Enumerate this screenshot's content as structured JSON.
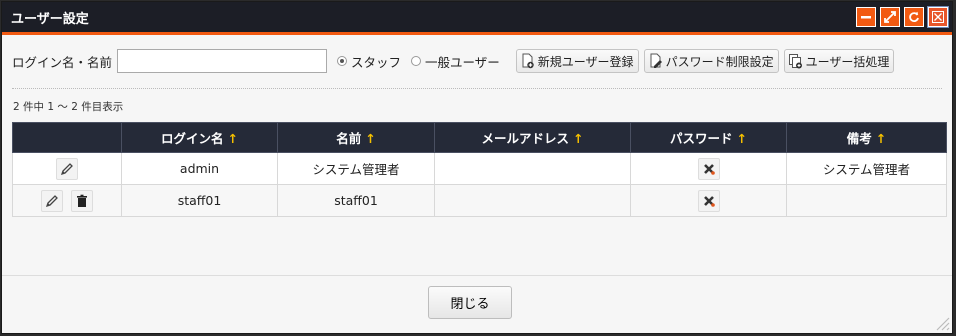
{
  "window": {
    "title": "ユーザー設定"
  },
  "toolbar": {
    "search_label": "ログイン名・名前",
    "search_value": "",
    "radio_staff": "スタッフ",
    "radio_general": "一般ユーザー",
    "new_user": "新規ユーザー登録",
    "password_policy": "パスワード制限設定",
    "bulk_process": "ユーザー括処理"
  },
  "count_text": "2 件中 1 ～ 2 件目表示",
  "table": {
    "headers": [
      "ログイン名",
      "名前",
      "メールアドレス",
      "パスワード",
      "備考"
    ],
    "sort_arrow": "↑",
    "rows": [
      {
        "login": "admin",
        "name": "システム管理者",
        "email": "",
        "note": "システム管理者"
      },
      {
        "login": "staff01",
        "name": "staff01",
        "email": "",
        "note": ""
      }
    ]
  },
  "footer": {
    "close": "閉じる"
  },
  "colors": {
    "accent": "#f25a12",
    "header_bg": "#252a38",
    "titlebar_bg": "#1c1e26"
  }
}
